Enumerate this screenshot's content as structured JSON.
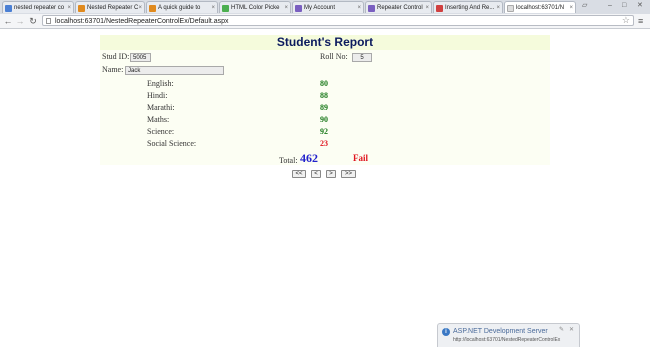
{
  "browser": {
    "tabs": [
      {
        "label": "nested repeater co",
        "color": "#4a7fd4"
      },
      {
        "label": "Nested Repeater C",
        "color": "#e08a1e"
      },
      {
        "label": "A quick guide to",
        "color": "#e08a1e"
      },
      {
        "label": "HTML Color Picke",
        "color": "#4caf50"
      },
      {
        "label": "My Account",
        "color": "#7a5fc0"
      },
      {
        "label": "Repeater Control",
        "color": "#7a5fc0"
      },
      {
        "label": "Inserting And Re...",
        "color": "#d04040"
      },
      {
        "label": "localhost:63701/N",
        "color": "#dddddd"
      }
    ],
    "url": "localhost:63701/NestedRepeaterControlEx/Default.aspx"
  },
  "report": {
    "title": "Student's Report",
    "stud_id_label": "Stud ID:",
    "stud_id_value": "5005",
    "roll_no_label": "Roll No:",
    "roll_no_value": "5",
    "name_label": "Name:",
    "name_value": "Jack",
    "subjects": [
      {
        "name": "English:",
        "score": "80",
        "color": "#1b7a1b"
      },
      {
        "name": "Hindi:",
        "score": "88",
        "color": "#1b7a1b"
      },
      {
        "name": "Marathi:",
        "score": "89",
        "color": "#1b7a1b"
      },
      {
        "name": "Maths:",
        "score": "90",
        "color": "#1b7a1b"
      },
      {
        "name": "Science:",
        "score": "92",
        "color": "#1b7a1b"
      },
      {
        "name": "Social Science:",
        "score": "23",
        "color": "#e0141e"
      }
    ],
    "total_label": "Total:",
    "total_value": "462",
    "result": "Fail"
  },
  "pager": {
    "first": "<<",
    "prev": "<",
    "next": ">",
    "last": ">>"
  },
  "notification": {
    "title": "ASP.NET Development Server",
    "url": "http://localhost:63701/NestedRepeaterControlEx"
  }
}
